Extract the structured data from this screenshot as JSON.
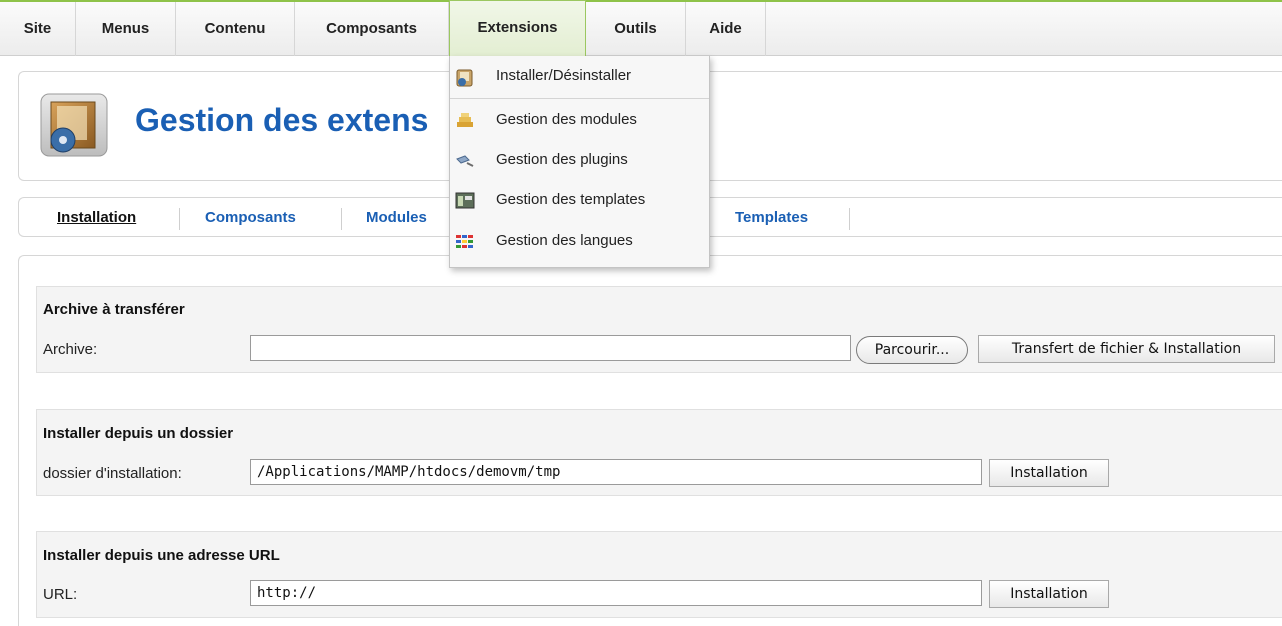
{
  "menubar": {
    "items": [
      {
        "label": "Site"
      },
      {
        "label": "Menus"
      },
      {
        "label": "Contenu"
      },
      {
        "label": "Composants"
      },
      {
        "label": "Extensions"
      },
      {
        "label": "Outils"
      },
      {
        "label": "Aide"
      }
    ],
    "active_item": "Extensions",
    "accent_color": "#8fc34a"
  },
  "dropdown": {
    "items": [
      {
        "label": "Installer/Désinstaller",
        "icon": "install-icon"
      },
      {
        "label": "Gestion des modules",
        "icon": "modules-icon"
      },
      {
        "label": "Gestion des plugins",
        "icon": "plugins-icon"
      },
      {
        "label": "Gestion des templates",
        "icon": "templates-icon"
      },
      {
        "label": "Gestion des langues",
        "icon": "languages-icon"
      }
    ]
  },
  "header": {
    "title": "Gestion des extens",
    "icon": "extension-manager-icon",
    "title_color": "#1a5fb4"
  },
  "tabs": {
    "items": [
      {
        "label": "Installation"
      },
      {
        "label": "Composants"
      },
      {
        "label": "Modules"
      },
      {
        "label": "Templates"
      }
    ],
    "current": "Installation"
  },
  "upload": {
    "title": "Archive à transférer",
    "label": "Archive:",
    "value": "",
    "browse_label": "Parcourir...",
    "submit_label": "Transfert de fichier & Installation"
  },
  "folder": {
    "title": "Installer depuis un dossier",
    "label": "dossier d'installation:",
    "value": "/Applications/MAMP/htdocs/demovm/tmp",
    "submit_label": "Installation"
  },
  "url": {
    "title": "Installer depuis une adresse URL",
    "label": "URL:",
    "value": "http://",
    "submit_label": "Installation"
  }
}
